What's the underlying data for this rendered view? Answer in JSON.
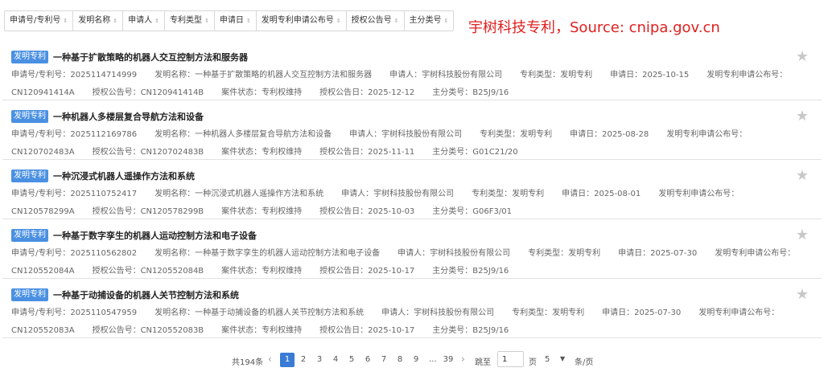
{
  "sort_bar": [
    {
      "label": "申请号/专利号"
    },
    {
      "label": "发明名称"
    },
    {
      "label": "申请人"
    },
    {
      "label": "专利类型"
    },
    {
      "label": "申请日"
    },
    {
      "label": "发明专利申请公布号"
    },
    {
      "label": "授权公告号"
    },
    {
      "label": "主分类号"
    }
  ],
  "watermark": "宇树科技专利，Source: cnipa.gov.cn",
  "labels": {
    "app_no": "申请号/专利号：",
    "name": "发明名称：",
    "applicant": "申请人：",
    "type": "专利类型：",
    "app_date": "申请日：",
    "pub_no": "发明专利申请公布号：",
    "grant_no": "授权公告号：",
    "status": "案件状态：",
    "grant_date": "授权公告日：",
    "ipc": "主分类号："
  },
  "results": [
    {
      "badge": "发明专利",
      "title": "一种基于扩散策略的机器人交互控制方法和服务器",
      "app_no": "2025114714999",
      "name": "一种基于扩散策略的机器人交互控制方法和服务器",
      "applicant": "宇树科技股份有限公司",
      "type": "发明专利",
      "app_date": "2025-10-15",
      "pub_no": "CN120941414A",
      "grant_no": "CN120941414B",
      "status": "专利权维持",
      "grant_date": "2025-12-12",
      "ipc": "B25J9/16"
    },
    {
      "badge": "发明专利",
      "title": "一种机器人多楼层复合导航方法和设备",
      "app_no": "2025112169786",
      "name": "一种机器人多楼层复合导航方法和设备",
      "applicant": "宇树科技股份有限公司",
      "type": "发明专利",
      "app_date": "2025-08-28",
      "pub_no": "CN120702483A",
      "grant_no": "CN120702483B",
      "status": "专利权维持",
      "grant_date": "2025-11-11",
      "ipc": "G01C21/20"
    },
    {
      "badge": "发明专利",
      "title": "一种沉浸式机器人遥操作方法和系统",
      "app_no": "2025110752417",
      "name": "一种沉浸式机器人遥操作方法和系统",
      "applicant": "宇树科技股份有限公司",
      "type": "发明专利",
      "app_date": "2025-08-01",
      "pub_no": "CN120578299A",
      "grant_no": "CN120578299B",
      "status": "专利权维持",
      "grant_date": "2025-10-03",
      "ipc": "G06F3/01"
    },
    {
      "badge": "发明专利",
      "title": "一种基于数字孪生的机器人运动控制方法和电子设备",
      "app_no": "2025110562802",
      "name": "一种基于数字孪生的机器人运动控制方法和电子设备",
      "applicant": "宇树科技股份有限公司",
      "type": "发明专利",
      "app_date": "2025-07-30",
      "pub_no": "CN120552084A",
      "grant_no": "CN120552084B",
      "status": "专利权维持",
      "grant_date": "2025-10-17",
      "ipc": "B25J9/16"
    },
    {
      "badge": "发明专利",
      "title": "一种基于动捕设备的机器人关节控制方法和系统",
      "app_no": "2025110547959",
      "name": "一种基于动捕设备的机器人关节控制方法和系统",
      "applicant": "宇树科技股份有限公司",
      "type": "发明专利",
      "app_date": "2025-07-30",
      "pub_no": "CN120552083A",
      "grant_no": "CN120552083B",
      "status": "专利权维持",
      "grant_date": "2025-10-17",
      "ipc": "B25J9/16"
    }
  ],
  "pagination": {
    "total": "共194条",
    "pages": [
      "1",
      "2",
      "3",
      "4",
      "5",
      "6",
      "7",
      "8",
      "9"
    ],
    "current": "1",
    "ellipsis": "...",
    "last": "39",
    "jump_label": "跳至",
    "jump_value": "1",
    "page_label": "页",
    "page_size": "5",
    "page_size_unit": "条/页"
  }
}
